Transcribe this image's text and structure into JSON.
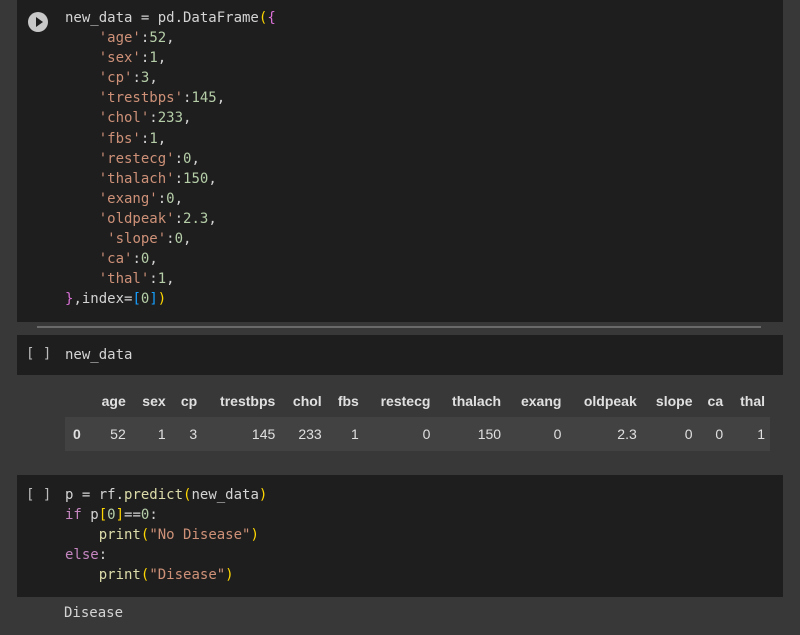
{
  "cell1": {
    "lines": [
      [
        {
          "t": "new_data = pd.DataFrame",
          "c": "plain"
        },
        {
          "t": "(",
          "c": "b1"
        },
        {
          "t": "{",
          "c": "b2"
        }
      ],
      [
        {
          "t": "    ",
          "c": "plain"
        },
        {
          "t": "'age'",
          "c": "str"
        },
        {
          "t": ":",
          "c": "plain"
        },
        {
          "t": "52",
          "c": "num"
        },
        {
          "t": ",",
          "c": "plain"
        }
      ],
      [
        {
          "t": "    ",
          "c": "plain"
        },
        {
          "t": "'sex'",
          "c": "str"
        },
        {
          "t": ":",
          "c": "plain"
        },
        {
          "t": "1",
          "c": "num"
        },
        {
          "t": ",",
          "c": "plain"
        }
      ],
      [
        {
          "t": "    ",
          "c": "plain"
        },
        {
          "t": "'cp'",
          "c": "str"
        },
        {
          "t": ":",
          "c": "plain"
        },
        {
          "t": "3",
          "c": "num"
        },
        {
          "t": ",",
          "c": "plain"
        }
      ],
      [
        {
          "t": "    ",
          "c": "plain"
        },
        {
          "t": "'trestbps'",
          "c": "str"
        },
        {
          "t": ":",
          "c": "plain"
        },
        {
          "t": "145",
          "c": "num"
        },
        {
          "t": ",",
          "c": "plain"
        }
      ],
      [
        {
          "t": "    ",
          "c": "plain"
        },
        {
          "t": "'chol'",
          "c": "str"
        },
        {
          "t": ":",
          "c": "plain"
        },
        {
          "t": "233",
          "c": "num"
        },
        {
          "t": ",",
          "c": "plain"
        }
      ],
      [
        {
          "t": "    ",
          "c": "plain"
        },
        {
          "t": "'fbs'",
          "c": "str"
        },
        {
          "t": ":",
          "c": "plain"
        },
        {
          "t": "1",
          "c": "num"
        },
        {
          "t": ",",
          "c": "plain"
        }
      ],
      [
        {
          "t": "    ",
          "c": "plain"
        },
        {
          "t": "'restecg'",
          "c": "str"
        },
        {
          "t": ":",
          "c": "plain"
        },
        {
          "t": "0",
          "c": "num"
        },
        {
          "t": ",",
          "c": "plain"
        }
      ],
      [
        {
          "t": "    ",
          "c": "plain"
        },
        {
          "t": "'thalach'",
          "c": "str"
        },
        {
          "t": ":",
          "c": "plain"
        },
        {
          "t": "150",
          "c": "num"
        },
        {
          "t": ",",
          "c": "plain"
        }
      ],
      [
        {
          "t": "    ",
          "c": "plain"
        },
        {
          "t": "'exang'",
          "c": "str"
        },
        {
          "t": ":",
          "c": "plain"
        },
        {
          "t": "0",
          "c": "num"
        },
        {
          "t": ",",
          "c": "plain"
        }
      ],
      [
        {
          "t": "    ",
          "c": "plain"
        },
        {
          "t": "'oldpeak'",
          "c": "str"
        },
        {
          "t": ":",
          "c": "plain"
        },
        {
          "t": "2.3",
          "c": "num"
        },
        {
          "t": ",",
          "c": "plain"
        }
      ],
      [
        {
          "t": "     ",
          "c": "plain"
        },
        {
          "t": "'slope'",
          "c": "str"
        },
        {
          "t": ":",
          "c": "plain"
        },
        {
          "t": "0",
          "c": "num"
        },
        {
          "t": ",",
          "c": "plain"
        }
      ],
      [
        {
          "t": "    ",
          "c": "plain"
        },
        {
          "t": "'ca'",
          "c": "str"
        },
        {
          "t": ":",
          "c": "plain"
        },
        {
          "t": "0",
          "c": "num"
        },
        {
          "t": ",",
          "c": "plain"
        }
      ],
      [
        {
          "t": "    ",
          "c": "plain"
        },
        {
          "t": "'thal'",
          "c": "str"
        },
        {
          "t": ":",
          "c": "plain"
        },
        {
          "t": "1",
          "c": "num"
        },
        {
          "t": ",",
          "c": "plain"
        }
      ],
      [
        {
          "t": "}",
          "c": "b2"
        },
        {
          "t": ",index=",
          "c": "plain"
        },
        {
          "t": "[",
          "c": "b3"
        },
        {
          "t": "0",
          "c": "num"
        },
        {
          "t": "]",
          "c": "b3"
        },
        {
          "t": ")",
          "c": "b1"
        }
      ]
    ]
  },
  "cell2": {
    "bracket": "[ ]",
    "lines": [
      [
        {
          "t": "new_data",
          "c": "plain"
        }
      ]
    ]
  },
  "table": {
    "columns": [
      "",
      "age",
      "sex",
      "cp",
      "trestbps",
      "chol",
      "fbs",
      "restecg",
      "thalach",
      "exang",
      "oldpeak",
      "slope",
      "ca",
      "thal"
    ],
    "rows": [
      [
        "0",
        "52",
        "1",
        "3",
        "145",
        "233",
        "1",
        "0",
        "150",
        "0",
        "2.3",
        "0",
        "0",
        "1"
      ]
    ]
  },
  "cell3": {
    "bracket": "[ ]",
    "lines": [
      [
        {
          "t": "p = rf.",
          "c": "plain"
        },
        {
          "t": "predict",
          "c": "fn"
        },
        {
          "t": "(",
          "c": "b1"
        },
        {
          "t": "new_data",
          "c": "plain"
        },
        {
          "t": ")",
          "c": "b1"
        }
      ],
      [
        {
          "t": "if",
          "c": "kw"
        },
        {
          "t": " p",
          "c": "plain"
        },
        {
          "t": "[",
          "c": "b1"
        },
        {
          "t": "0",
          "c": "num"
        },
        {
          "t": "]",
          "c": "b1"
        },
        {
          "t": "==",
          "c": "plain"
        },
        {
          "t": "0",
          "c": "num"
        },
        {
          "t": ":",
          "c": "plain"
        }
      ],
      [
        {
          "t": "    ",
          "c": "plain"
        },
        {
          "t": "print",
          "c": "fn"
        },
        {
          "t": "(",
          "c": "b1"
        },
        {
          "t": "\"No Disease\"",
          "c": "str"
        },
        {
          "t": ")",
          "c": "b1"
        }
      ],
      [
        {
          "t": "else",
          "c": "kw"
        },
        {
          "t": ":",
          "c": "plain"
        }
      ],
      [
        {
          "t": "    ",
          "c": "plain"
        },
        {
          "t": "print",
          "c": "fn"
        },
        {
          "t": "(",
          "c": "b1"
        },
        {
          "t": "\"Disease\"",
          "c": "str"
        },
        {
          "t": ")",
          "c": "b1"
        }
      ]
    ]
  },
  "output": {
    "text": "Disease"
  }
}
